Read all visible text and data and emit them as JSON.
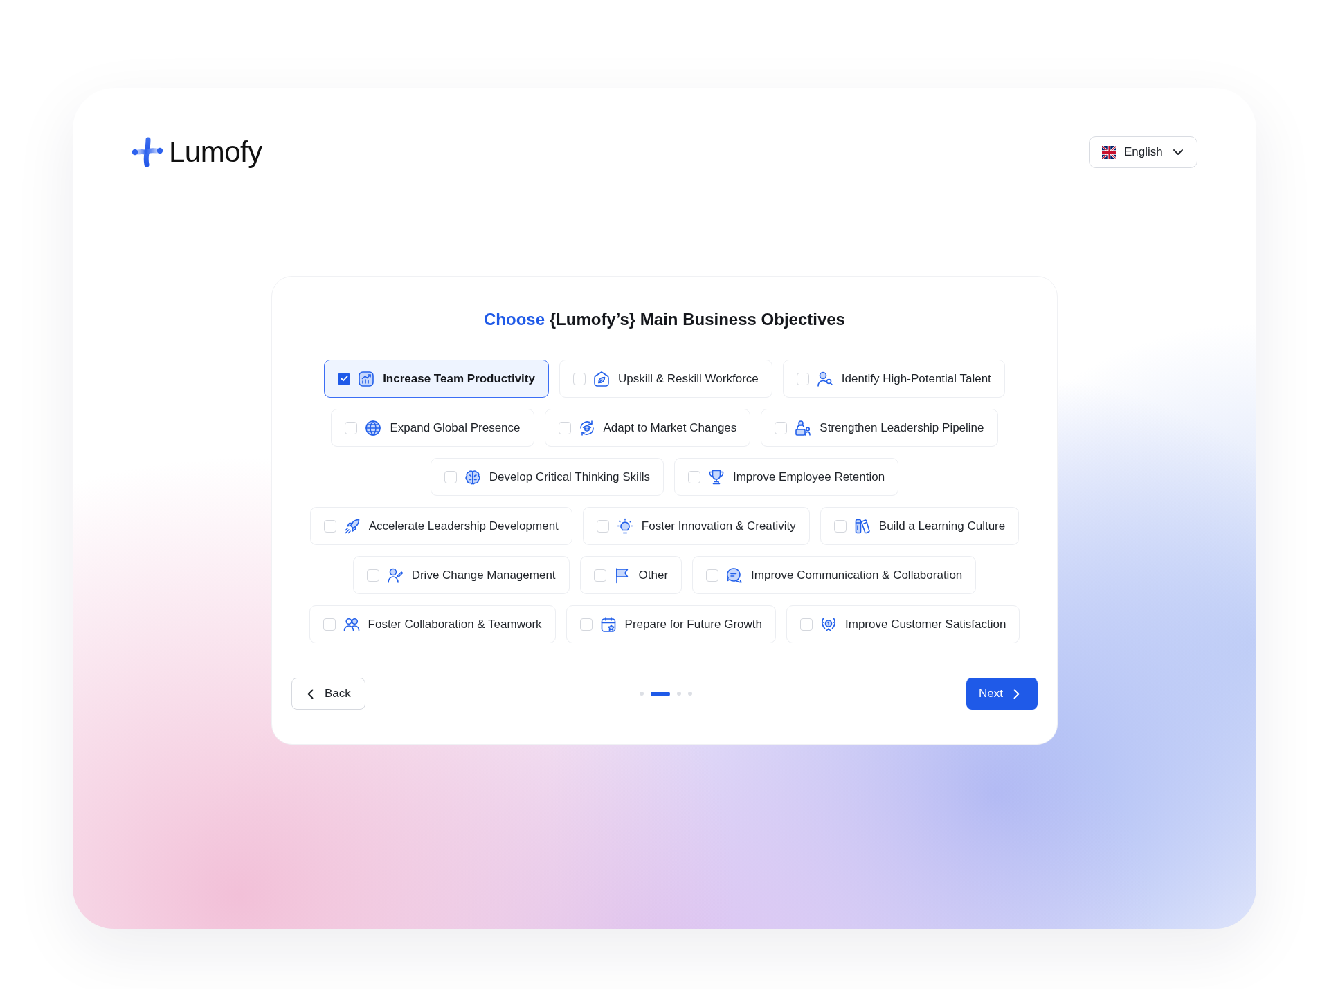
{
  "brand": {
    "name": "Lumofy"
  },
  "language_selector": {
    "value": "English"
  },
  "title": {
    "highlight": "Choose",
    "rest": "{Lumofy’s} Main Business Objectives"
  },
  "objective_rows": [
    {
      "options": [
        {
          "label": "Increase Team Productivity",
          "checked": true
        },
        {
          "label": "Upskill & Reskill Workforce",
          "checked": false
        },
        {
          "label": "Identify High-Potential Talent",
          "checked": false
        }
      ]
    },
    {
      "options": [
        {
          "label": "Expand Global Presence",
          "checked": false
        },
        {
          "label": "Adapt to Market Changes",
          "checked": false
        },
        {
          "label": "Strengthen Leadership Pipeline",
          "checked": false
        }
      ]
    },
    {
      "options": [
        {
          "label": "Develop Critical Thinking Skills",
          "checked": false
        },
        {
          "label": "Improve Employee Retention",
          "checked": false
        }
      ]
    },
    {
      "options": [
        {
          "label": "Accelerate Leadership Development",
          "checked": false
        },
        {
          "label": "Foster Innovation & Creativity",
          "checked": false
        },
        {
          "label": "Build a Learning Culture",
          "checked": false
        }
      ]
    },
    {
      "options": [
        {
          "label": "Drive Change Management",
          "checked": false
        },
        {
          "label": "Other",
          "checked": false
        },
        {
          "label": "Improve Communication & Collaboration",
          "checked": false
        }
      ]
    },
    {
      "options": [
        {
          "label": "Foster Collaboration & Teamwork",
          "checked": false
        },
        {
          "label": "Prepare for Future Growth",
          "checked": false
        },
        {
          "label": "Improve Customer Satisfaction",
          "checked": false
        }
      ]
    }
  ],
  "pagination": [
    {
      "selected": false
    },
    {
      "selected": true
    },
    {
      "selected": false
    },
    {
      "selected": false
    }
  ],
  "back_button": {
    "label": "Back"
  },
  "next_button": {
    "label": "Next"
  }
}
